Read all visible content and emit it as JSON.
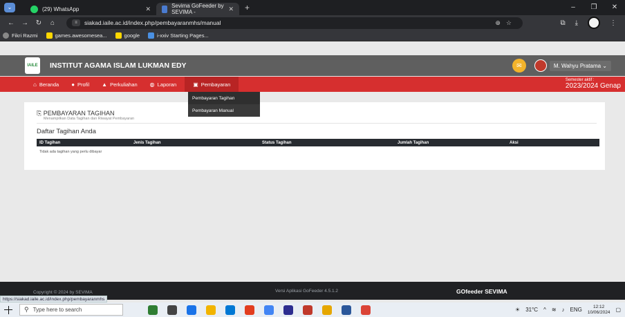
{
  "browser": {
    "tabs": [
      {
        "label": "(29) WhatsApp",
        "favicon_color": "#25d366"
      },
      {
        "label": "Sevima GoFeeder by SEVIMA -",
        "favicon_color": "#4a7bd0"
      }
    ],
    "new_tab": "+",
    "url": "siakad.iaile.ac.id/index.php/pembayaranmhs/manual",
    "bookmarks": [
      {
        "label": "Fikri Razmi",
        "color": "#888"
      },
      {
        "label": "games.awesomesea...",
        "color": "#ffd700"
      },
      {
        "label": "google",
        "color": "#ffd700"
      },
      {
        "label": "i-xxiv Starting Pages...",
        "color": "#4a90e2"
      }
    ]
  },
  "site": {
    "logo_text": "IAILE",
    "title": "INSTITUT AGAMA ISLAM LUKMAN EDY",
    "user_name": "M. Wahyu Pratama",
    "nav": [
      {
        "label": "Beranda",
        "icon": "home-icon",
        "glyph": "⌂"
      },
      {
        "label": "Profil",
        "icon": "user-icon",
        "glyph": "👤"
      },
      {
        "label": "Perkuliahan",
        "icon": "graduation-icon",
        "glyph": "🎓"
      },
      {
        "label": "Laporan",
        "icon": "globe-icon",
        "glyph": "◍"
      },
      {
        "label": "Pembayaran",
        "icon": "money-icon",
        "glyph": "▣"
      }
    ],
    "semester_label": "Semester aktif :",
    "semester_value": "2023/2024 Genap",
    "dropdown": [
      "Pembayaran Tagihan",
      "Pembayaran Manual"
    ]
  },
  "content": {
    "card_title": "PEMBAYARAN TAGIHAN",
    "card_subtitle": "Menampilkan Data Tagihan dan Riwayat Pembayaran",
    "section_title": "Daftar Tagihan Anda",
    "columns": [
      "ID Tagihan",
      "Jenis Tagihan",
      "Status Tagihan",
      "Jumlah Tagihan",
      "Aksi"
    ],
    "empty_message": "Tidak ada tagihan yang perlu dibayar"
  },
  "footer": {
    "copyright": "Copyright © 2024 by SEVIMA",
    "version": "Versi Aplikasi GoFeeder 4.5.1.2",
    "brand": "GOfeeder SEVIMA"
  },
  "status_url": "https://siakad.iaile.ac.id/index.php/pembayaranmhs",
  "taskbar": {
    "search_placeholder": "Type here to search",
    "apps": [
      "#2f7d32",
      "#444",
      "#1a73e8",
      "#f2b400",
      "#0078d4",
      "#e23d1f",
      "#4285f4",
      "#2d2d8f",
      "#c0392b",
      "#e6a700",
      "#2b579a",
      "#db4437"
    ],
    "weather": "31°C",
    "lang": "ENG",
    "time": "12:12",
    "date": "10/06/2024"
  }
}
